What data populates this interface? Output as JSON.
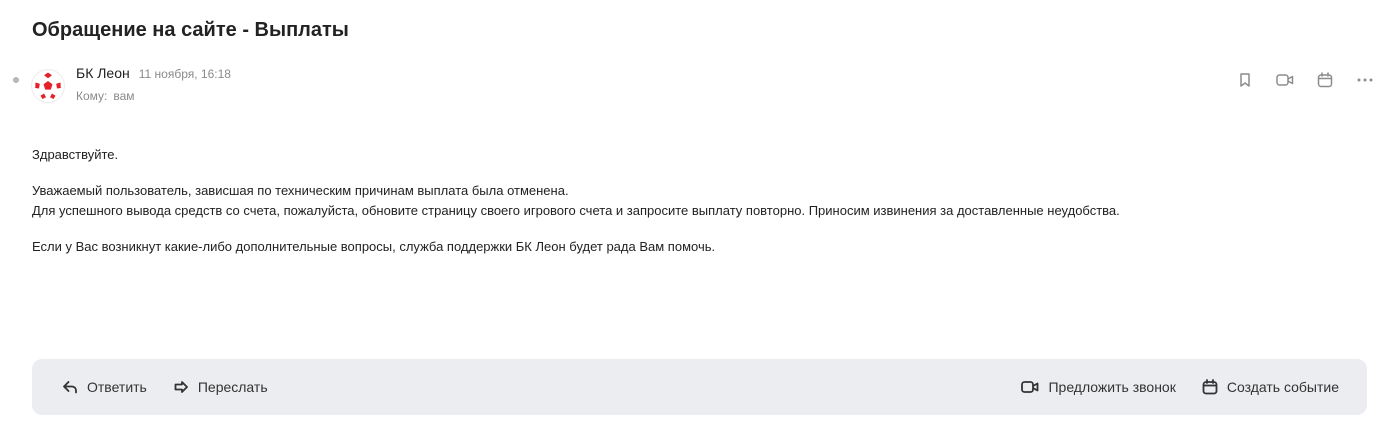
{
  "message": {
    "subject": "Обращение на сайте - Выплаты",
    "sender": {
      "name": "БК Леон",
      "date": "11 ноября, 16:18"
    },
    "recipient": {
      "label": "Кому:",
      "value": "вам"
    },
    "body": {
      "greeting": "Здравствуйте.",
      "paragraph1_line1": "Уважаемый пользователь, зависшая по техническим причинам выплата была отменена.",
      "paragraph1_line2": "Для успешного вывода средств со счета, пожалуйста, обновите страницу своего игрового счета и запросите выплату повторно. Приносим извинения за доставленные неудобства.",
      "paragraph2": "Если у Вас возникнут какие-либо дополнительные вопросы, служба поддержки БК Леон будет рада Вам помочь."
    }
  },
  "header_actions": {
    "icons": [
      "bookmark-icon",
      "video-call-icon",
      "calendar-icon",
      "more-icon"
    ]
  },
  "reply_bar": {
    "reply_label": "Ответить",
    "forward_label": "Переслать",
    "propose_call_label": "Предложить звонок",
    "create_event_label": "Создать событие"
  },
  "colors": {
    "avatar_red": "#e4212a",
    "bar_background": "#ebedf0",
    "muted_text": "#8a8a8a"
  }
}
